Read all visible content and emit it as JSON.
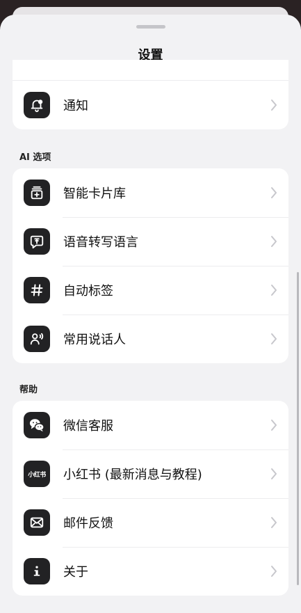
{
  "header": {
    "title": "设置"
  },
  "groups": {
    "general": {
      "items": [
        {
          "label": "通知",
          "icon": "bell-icon"
        }
      ]
    },
    "ai": {
      "title": "AI 选项",
      "items": [
        {
          "label": "智能卡片库",
          "icon": "card-library-icon"
        },
        {
          "label": "语音转写语言",
          "icon": "transcribe-language-icon"
        },
        {
          "label": "自动标签",
          "icon": "hashtag-icon"
        },
        {
          "label": "常用说话人",
          "icon": "speaker-person-icon"
        }
      ]
    },
    "help": {
      "title": "帮助",
      "items": [
        {
          "label": "微信客服",
          "icon": "wechat-icon"
        },
        {
          "label": "小红书 (最新消息与教程)",
          "icon": "xiaohongshu-icon",
          "icon_text": "小红书"
        },
        {
          "label": "邮件反馈",
          "icon": "mail-icon"
        },
        {
          "label": "关于",
          "icon": "info-icon"
        }
      ]
    }
  },
  "colors": {
    "sheet_bg": "#f2f2f4",
    "card_bg": "#ffffff",
    "icon_bg": "#222224",
    "chevron": "#c7c7cc"
  }
}
